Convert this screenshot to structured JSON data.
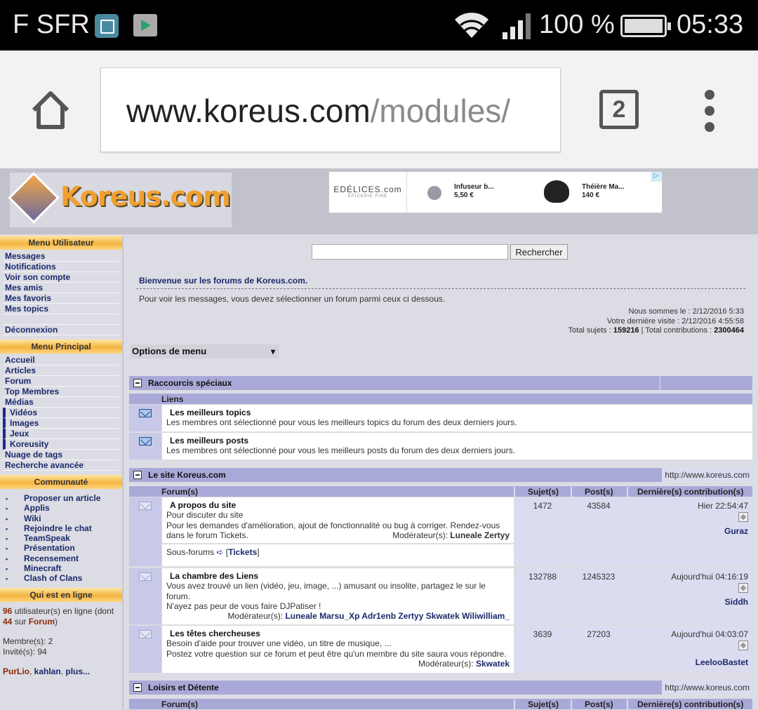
{
  "status_bar": {
    "carrier": "F SFR",
    "battery": "100 %",
    "time": "05:33",
    "icons": [
      "gallery-icon",
      "play-store-icon",
      "wifi-icon",
      "signal-icon",
      "battery-icon"
    ]
  },
  "browser": {
    "url_host": "www.koreus.com",
    "url_path": "/modules/",
    "tab_count": "2"
  },
  "site": {
    "logo_text": "Koreus.com",
    "ad": {
      "brand": "EDÉLICES.com",
      "brand_sub": "ÉPICERIE FINE",
      "item1_name": "Infuseur b...",
      "item1_price": "5,50 €",
      "item2_name": "Théière Ma...",
      "item2_price": "140 €"
    }
  },
  "sidebar": {
    "menu_user_title": "Menu Utilisateur",
    "menu_user": [
      "Messages",
      "Notifications",
      "Voir son compte",
      "Mes amis",
      "Mes favoris",
      "Mes topics",
      "",
      "Déconnexion"
    ],
    "menu_main_title": "Menu Principal",
    "menu_main": [
      "Accueil",
      "Articles",
      "Forum",
      "Top Membres",
      "Médias"
    ],
    "menu_media": [
      "Vidéos",
      "Images",
      "Jeux",
      "Koreusity"
    ],
    "menu_main_more": [
      "Nuage de tags",
      "Recherche avancée"
    ],
    "community_title": "Communauté",
    "community": [
      "Proposer un article",
      "Applis",
      "Wiki",
      "Rejoindre le chat",
      "TeamSpeak",
      "Présentation",
      "Recensement",
      "Minecraft",
      "Clash of Clans"
    ],
    "online_title": "Qui est en ligne",
    "online": {
      "users_count": "96",
      "users_text": " utilisateur(s) en ligne (dont ",
      "forum_count": "44",
      "forum_text_a": " sur ",
      "forum_link": "Forum",
      "forum_text_b": ")",
      "members": "Membre(s): 2",
      "guests": "Invité(s): 94",
      "names": [
        "PurLio",
        "kahlan",
        "plus..."
      ]
    }
  },
  "main": {
    "search_button": "Rechercher",
    "search_value": "",
    "welcome": "Bienvenue sur les forums de Koreus.com.",
    "instructions": "Pour voir les messages, vous devez sélectionner un forum parmi ceux ci dessous.",
    "now": "Nous sommes le : 2/12/2016 5:33",
    "last_visit": "Votre dernière visite : 2/12/2016 4:55:58",
    "totals_label_a": "Total sujets : ",
    "total_topics": "159216",
    "totals_label_b": " | Total contributions : ",
    "total_posts": "2300464",
    "options_label": "Options de menu",
    "cat1": {
      "title": "Raccourcis spéciaux",
      "col": "Liens",
      "rows": [
        {
          "title": "Les meilleurs topics",
          "desc": "Les membres ont sélectionné pour vous les meilleurs topics du forum des deux derniers jours."
        },
        {
          "title": "Les meilleurs posts",
          "desc": "Les membres ont sélectionné pour vous les meilleurs posts du forum des deux derniers jours."
        }
      ]
    },
    "cat2": {
      "title": "Le site Koreus.com",
      "url": "http://www.koreus.com",
      "cols": [
        "Forum(s)",
        "Sujet(s)",
        "Post(s)",
        "Dernière(s) contribution(s)"
      ],
      "rows": [
        {
          "title": "A propos du site",
          "line1": "Pour discuter du site",
          "line2": "Pour les demandes d'amélioration, ajout de fonctionnalité ou bug à corriger. Rendez-vous",
          "line3": "dans le forum Tickets.",
          "mod_label": "Modérateur(s): ",
          "mods": "Luneale Zertyy",
          "topics": "1472",
          "posts": "43584",
          "last_time": "Hier 22:54:47",
          "last_user": "Guraz",
          "subforums_label": "Sous-forums",
          "subforum": "Tickets"
        },
        {
          "title": "La chambre des Liens",
          "line1": "Vous avez trouvé un lien (vidéo, jeu, image, ...) amusant ou insolite, partagez le sur le",
          "line2": "forum.",
          "line3": "N'ayez pas peur de vous faire DJPatiser !",
          "mod_label": "Modérateur(s): ",
          "mods": "Luneale Marsu_Xp Adr1enb Zertyy Skwatek Wiliwilliam_",
          "topics": "132788",
          "posts": "1245323",
          "last_time": "Aujourd'hui 04:16:19",
          "last_user": "Siddh"
        },
        {
          "title": "Les têtes chercheuses",
          "line1": "Besoin d'aide pour trouver une vidéo, un titre de musique, ...",
          "line2": "Postez votre question sur ce forum et peut être qu'un membre du site saura vous répondre.",
          "mod_label": "Modérateur(s): ",
          "mods": "Skwatek",
          "topics": "3639",
          "posts": "27203",
          "last_time": "Aujourd'hui 04:03:07",
          "last_user": "LeelooBastet"
        }
      ]
    },
    "cat3": {
      "title": "Loisirs et Détente",
      "url": "http://www.koreus.com",
      "cols": [
        "Forum(s)",
        "Sujet(s)",
        "Post(s)",
        "Dernière(s) contribution(s)"
      ]
    }
  }
}
